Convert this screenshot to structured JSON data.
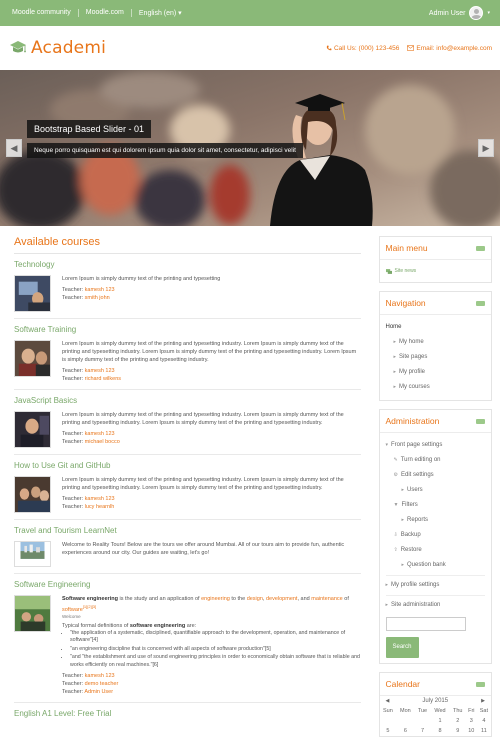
{
  "topbar": {
    "links": [
      "Moodle community",
      "Moodle.com",
      "English (en) ▾"
    ],
    "user_label": "Admin User",
    "user_caret": "▾"
  },
  "header": {
    "brand": "Academi",
    "phone_label": "Call Us: (000) 123-456",
    "email_label": "Email: info@example.com"
  },
  "slider": {
    "title": "Bootstrap Based Slider - 01",
    "caption": "Neque porro quisquam est qui dolorem ipsum quia dolor sit amet, consectetur, adipisci velit",
    "prev": "◀",
    "next": "▶"
  },
  "available_courses": {
    "title": "Available courses",
    "teacher_label": "Teacher:",
    "courses": [
      {
        "name": "Technology",
        "summary": "Lorem Ipsum is simply dummy text of the printing and typesetting",
        "teachers": [
          "kamesh 123",
          "smith john"
        ]
      },
      {
        "name": "Software Training",
        "summary": "Lorem Ipsum is simply dummy text of the printing and typesetting industry. Lorem Ipsum is simply dummy text of the printing and typesetting industry. Lorem Ipsum is simply dummy text of the printing and typesetting industry. Lorem Ipsum is simply dummy text of the printing and typesetting industry.",
        "teachers": [
          "kamesh 123",
          "richard wilkens"
        ]
      },
      {
        "name": "JavaScript Basics",
        "summary": "Lorem Ipsum is simply dummy text of the printing and typesetting industry. Lorem Ipsum is simply dummy text of the printing and typesetting industry. Lorem Ipsum is simply dummy text of the printing and typesetting industry.",
        "teachers": [
          "kamesh 123",
          "michael bocco"
        ]
      },
      {
        "name": "How to Use Git and GitHub",
        "summary": "Lorem Ipsum is simply dummy text of the printing and typesetting industry. Lorem Ipsum is simply dummy text of the printing and typesetting industry. Lorem Ipsum is simply dummy text of the printing and typesetting industry.",
        "teachers": [
          "kamesh 123",
          "lucy hearnlh"
        ]
      },
      {
        "name": "Travel and Tourism LearnNet",
        "summary": "Welcome to Reality Tours! Below are the tours we offer around Mumbai. All of our tours aim to provide fun, authentic experiences around our city. Our guides are waiting, let's go!",
        "teachers": []
      }
    ],
    "software_engineering": {
      "name": "Software Engineering",
      "intro_bold": "Software engineering",
      "intro_rest": " is the study and an application of ",
      "link1": "engineering",
      "mid": " to the ",
      "link2": "design",
      "comma": ", ",
      "link3": "development",
      "and": ", and ",
      "link4": "maintenance",
      "of": " of ",
      "link5": "software",
      "ref1": "[1][2][3]",
      "welcome": "Welcome",
      "defs_intro": "Typical formal definitions of ",
      "defs_bold": "software engineering",
      "defs_end": " are:",
      "defs": [
        "\"the application of a systematic, disciplined, quantifiable approach to the development, operation, and maintenance of software\"[4]",
        "\"an engineering discipline that is concerned with all aspects of software production\"[5]",
        "\"and \"the establishment and use of sound engineering principles in order to economically obtain software that is reliable and works efficiently on real machines.\"[6]"
      ],
      "teachers": [
        "kamesh 123",
        "demo teacher",
        "Admin User"
      ]
    },
    "next_course": "English A1 Level: Free Trial"
  },
  "blocks": {
    "main_menu": {
      "title": "Main menu",
      "item": "Site news"
    },
    "navigation": {
      "title": "Navigation",
      "home": "Home",
      "items": [
        "My home",
        "Site pages",
        "My profile",
        "My courses"
      ]
    },
    "administration": {
      "title": "Administration",
      "front_page": "Front page settings",
      "items": [
        "Turn editing on",
        "Edit settings",
        "Users",
        "Filters",
        "Reports",
        "Backup",
        "Restore",
        "Question bank"
      ],
      "profile_settings": "My profile settings",
      "site_admin": "Site administration",
      "search_button": "Search"
    },
    "calendar": {
      "title": "Calendar",
      "month": "July 2015",
      "prev": "◀",
      "next": "▶",
      "days": [
        "Sun",
        "Mon",
        "Tue",
        "Wed",
        "Thu",
        "Fri",
        "Sat"
      ],
      "weeks": [
        [
          "",
          "",
          "",
          "1",
          "2",
          "3",
          "4"
        ],
        [
          "5",
          "6",
          "7",
          "8",
          "9",
          "10",
          "11"
        ]
      ]
    }
  },
  "colors": {
    "accent": "#e8751a",
    "green": "#8ab978",
    "green_text": "#7aa86a"
  }
}
